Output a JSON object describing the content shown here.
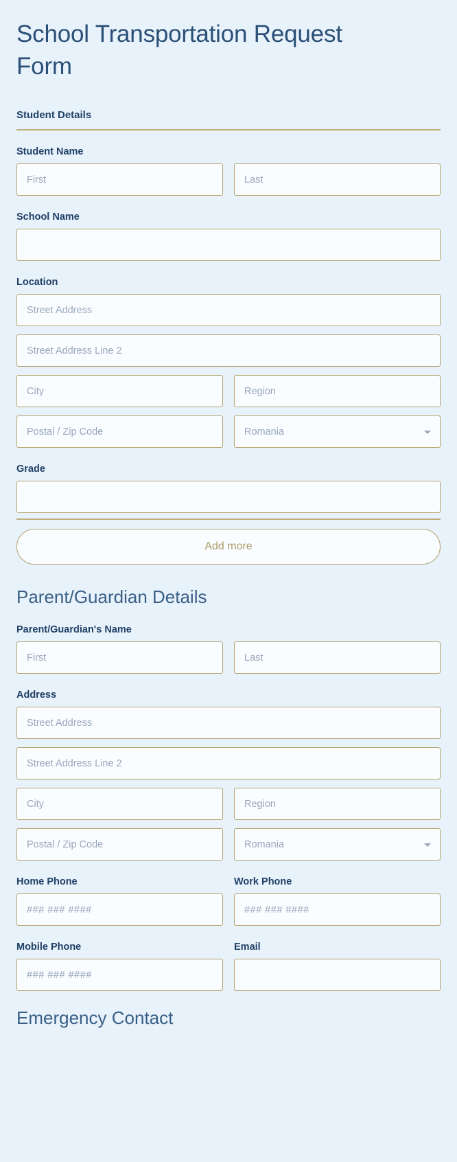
{
  "form": {
    "title": "School Transportation Request Form"
  },
  "student_section": {
    "heading": "Student Details",
    "student_name": {
      "label": "Student Name",
      "first_placeholder": "First",
      "last_placeholder": "Last",
      "first_value": "",
      "last_value": ""
    },
    "school_name": {
      "label": "School Name",
      "value": ""
    },
    "location": {
      "label": "Location",
      "street_placeholder": "Street Address",
      "street2_placeholder": "Street Address Line 2",
      "city_placeholder": "City",
      "region_placeholder": "Region",
      "postal_placeholder": "Postal / Zip Code",
      "country_value": "Romania",
      "street_value": "",
      "street2_value": "",
      "city_value": "",
      "region_value": "",
      "postal_value": ""
    },
    "grade": {
      "label": "Grade",
      "value": ""
    },
    "add_more_label": "Add more"
  },
  "parent_section": {
    "heading": "Parent/Guardian Details",
    "parent_name": {
      "label": "Parent/Guardian's Name",
      "first_placeholder": "First",
      "last_placeholder": "Last",
      "first_value": "",
      "last_value": ""
    },
    "address": {
      "label": "Address",
      "street_placeholder": "Street Address",
      "street2_placeholder": "Street Address Line 2",
      "city_placeholder": "City",
      "region_placeholder": "Region",
      "postal_placeholder": "Postal / Zip Code",
      "country_value": "Romania",
      "street_value": "",
      "street2_value": "",
      "city_value": "",
      "region_value": "",
      "postal_value": ""
    },
    "home_phone": {
      "label": "Home Phone",
      "placeholder": "### ### ####",
      "value": ""
    },
    "work_phone": {
      "label": "Work Phone",
      "placeholder": "### ### ####",
      "value": ""
    },
    "mobile_phone": {
      "label": "Mobile Phone",
      "placeholder": "### ### ####",
      "value": ""
    },
    "email": {
      "label": "Email",
      "placeholder": "",
      "value": ""
    }
  },
  "emergency_section": {
    "heading": "Emergency Contact"
  },
  "colors": {
    "page_background": "#e8f2fa",
    "field_background": "#fafdff",
    "field_border": "#b5a26c",
    "title_text": "#2b4f77",
    "label_text": "#1f3f66",
    "placeholder_text": "#98a6bb",
    "accent_rule": "#bfae79",
    "add_more_text": "#ab9a69"
  },
  "icons": {
    "dropdown_caret": "chevron-down-icon"
  }
}
